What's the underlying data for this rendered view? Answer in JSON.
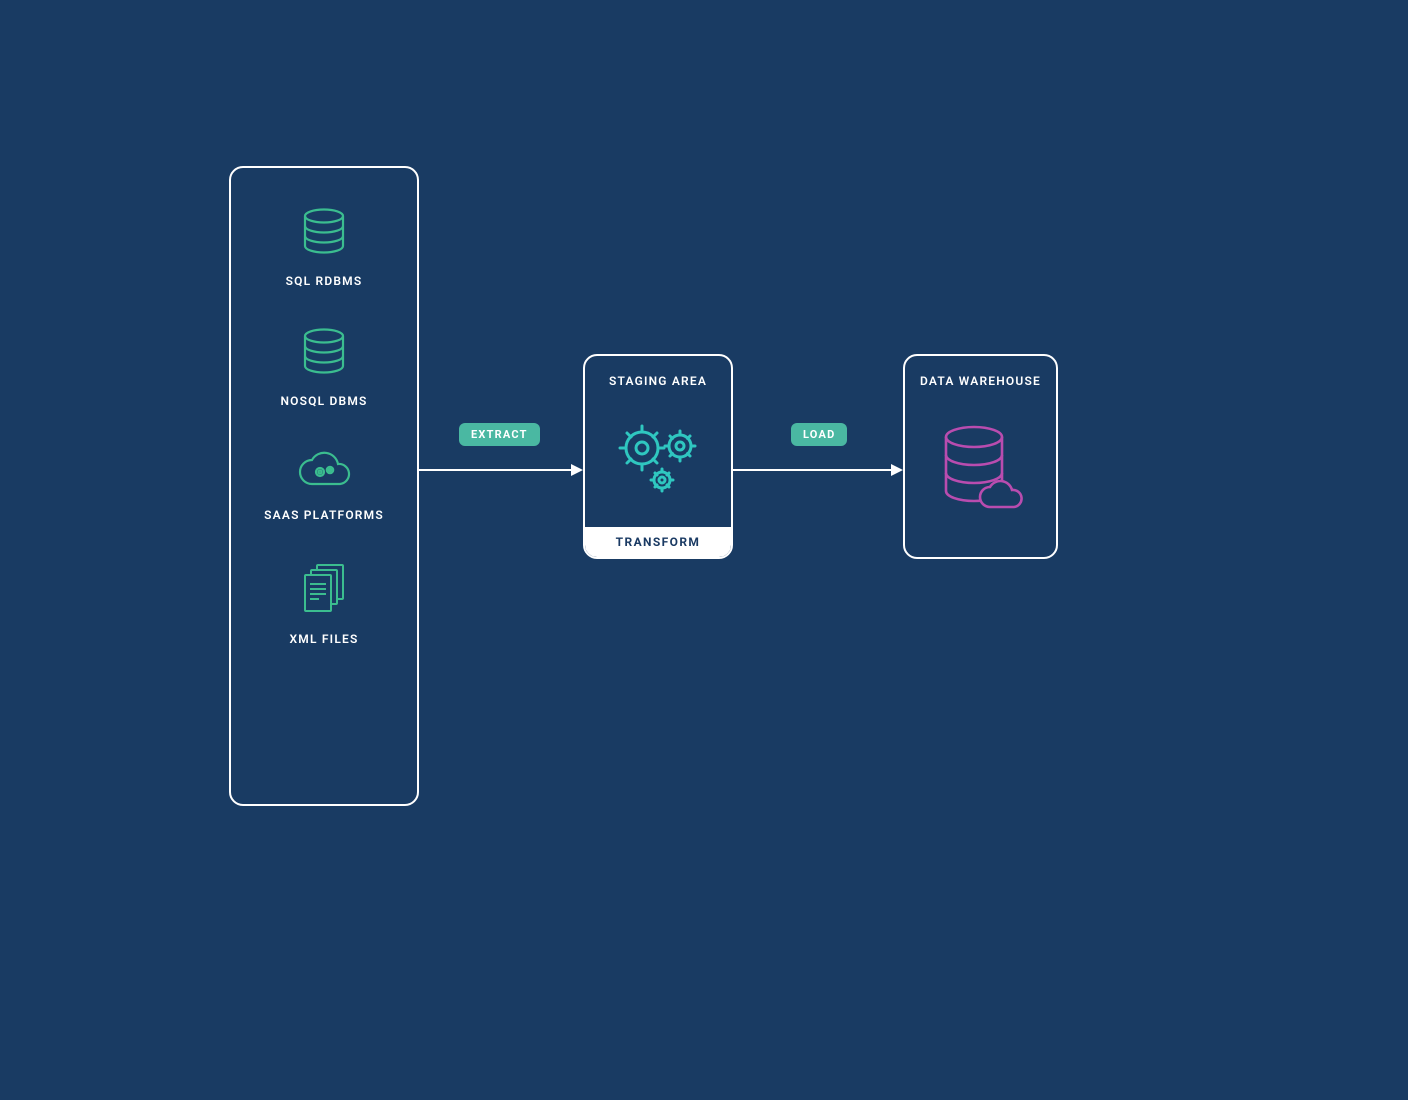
{
  "sources": {
    "items": [
      {
        "label": "SQL RDBMS",
        "icon": "database-icon"
      },
      {
        "label": "NOSQL DBMS",
        "icon": "database-icon"
      },
      {
        "label": "SAAS PLATFORMS",
        "icon": "cloud-gears-icon"
      },
      {
        "label": "XML FILES",
        "icon": "documents-icon"
      }
    ]
  },
  "arrows": {
    "extract_label": "EXTRACT",
    "load_label": "LOAD"
  },
  "staging": {
    "title": "STAGING AREA",
    "transform_label": "TRANSFORM"
  },
  "warehouse": {
    "title": "DATA WAREHOUSE"
  },
  "colors": {
    "background": "#193b63",
    "border": "#ffffff",
    "source_icon": "#3bbd8f",
    "staging_icon": "#2fc7c0",
    "warehouse_icon": "#b94caf",
    "pill": "#4ab8a2"
  }
}
